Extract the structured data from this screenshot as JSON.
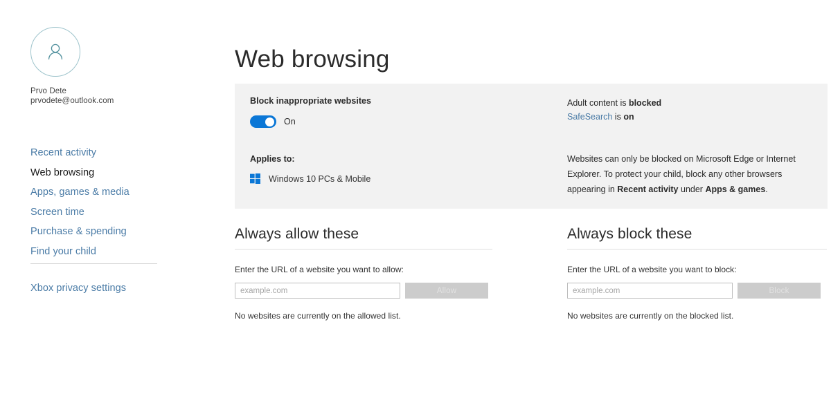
{
  "sidebar": {
    "avatar_icon": "person-avatar-icon",
    "profile": {
      "name": "Prvo Dete",
      "email": "prvodete@outlook.com"
    },
    "items": [
      {
        "label": "Recent activity",
        "active": false
      },
      {
        "label": "Web browsing",
        "active": true
      },
      {
        "label": "Apps, games & media",
        "active": false
      },
      {
        "label": "Screen time",
        "active": false
      },
      {
        "label": "Purchase & spending",
        "active": false
      },
      {
        "label": "Find your child",
        "active": false
      }
    ],
    "secondary_items": [
      {
        "label": "Xbox privacy settings"
      }
    ]
  },
  "main": {
    "page_title": "Web browsing",
    "info_panel": {
      "block_heading": "Block inappropriate websites",
      "toggle": {
        "state_label": "On",
        "on": true
      },
      "applies_to_label": "Applies to:",
      "platform": {
        "icon": "windows-logo-icon",
        "label": "Windows 10 PCs & Mobile"
      },
      "status": {
        "adult_content_prefix": "Adult content is ",
        "adult_content_value": "blocked",
        "safesearch_link": "SafeSearch",
        "safesearch_middle": " is ",
        "safesearch_value": "on"
      },
      "note": {
        "part1": "Websites can only be blocked on Microsoft Edge or Internet Explorer. To protect your child, block any other browsers appearing in ",
        "bold1": "Recent activity",
        "part2": " under ",
        "bold2": "Apps & games",
        "part3": "."
      }
    },
    "allow_section": {
      "title": "Always allow these",
      "prompt": "Enter the URL of a website you want to allow:",
      "input_placeholder": "example.com",
      "input_value": "",
      "button_label": "Allow",
      "empty_message": "No websites are currently on the allowed list."
    },
    "block_section": {
      "title": "Always block these",
      "prompt": "Enter the URL of a website you want to block:",
      "input_placeholder": "example.com",
      "input_value": "",
      "button_label": "Block",
      "empty_message": "No websites are currently on the blocked list."
    }
  },
  "colors": {
    "accent_blue": "#0b77d6",
    "link_blue": "#4a7ba6",
    "panel_grey": "#f2f2f2",
    "disabled_btn": "#cccccc",
    "avatar_teal": "#9ec4cc"
  }
}
